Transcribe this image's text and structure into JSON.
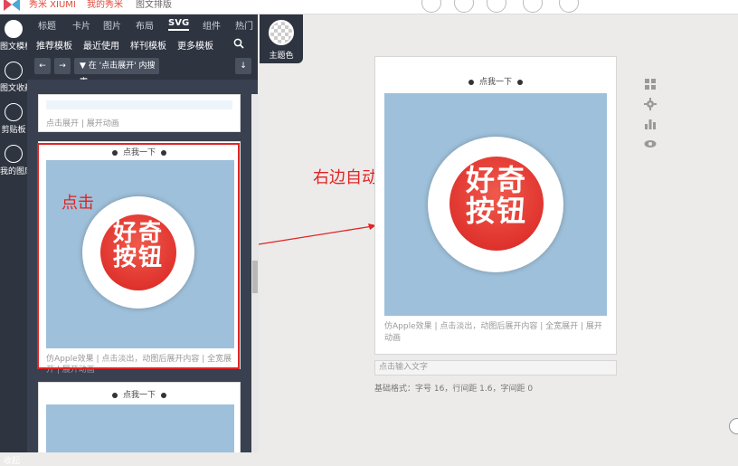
{
  "topbar": {
    "brand": "秀米 XIUMI",
    "crumb1": "我的秀米",
    "crumb2": "图文排版"
  },
  "left_rail": {
    "items": [
      {
        "label": "图文模板",
        "icon": "grid-icon"
      },
      {
        "label": "图文收藏",
        "icon": "folder-icon"
      },
      {
        "label": "剪贴板",
        "icon": "clipboard-icon"
      },
      {
        "label": "我的图库",
        "icon": "image-icon"
      }
    ],
    "bottom": "收起"
  },
  "tabs": [
    "标题",
    "卡片",
    "图片",
    "布局",
    "SVG",
    "组件",
    "热门"
  ],
  "active_tab": "SVG",
  "subtabs": [
    "推荐模板",
    "最近使用",
    "样刊模板",
    "更多模板"
  ],
  "theme_label": "主题色",
  "toolbar": {
    "back": "←",
    "forward": "→",
    "filter": "在 '点击展开' 内搜索",
    "sort": "↓"
  },
  "cards": [
    {
      "caption": "点击展开 | 展开动画"
    },
    {
      "press": "点我一下",
      "caption": "仿Apple效果 | 点击淡出，动图后展开内容 | 全宽展开 | 展开动画"
    },
    {
      "press": "点我一下"
    }
  ],
  "button_text": "好奇按钮",
  "annotations": {
    "left": "点击",
    "right": "右边自动对应"
  },
  "preview": {
    "press": "点我一下",
    "caption": "仿Apple效果 | 点击淡出，动图后展开内容 | 全宽展开 | 展开动画",
    "input_placeholder": "点击输入文字",
    "info": "基础格式：字号 16，行间距 1.6，字间距 0"
  },
  "colors": {
    "dark": "#2e3440",
    "accent_red": "#e02424",
    "blue_box": "#9ec0da",
    "button_red": "#e0332e"
  }
}
